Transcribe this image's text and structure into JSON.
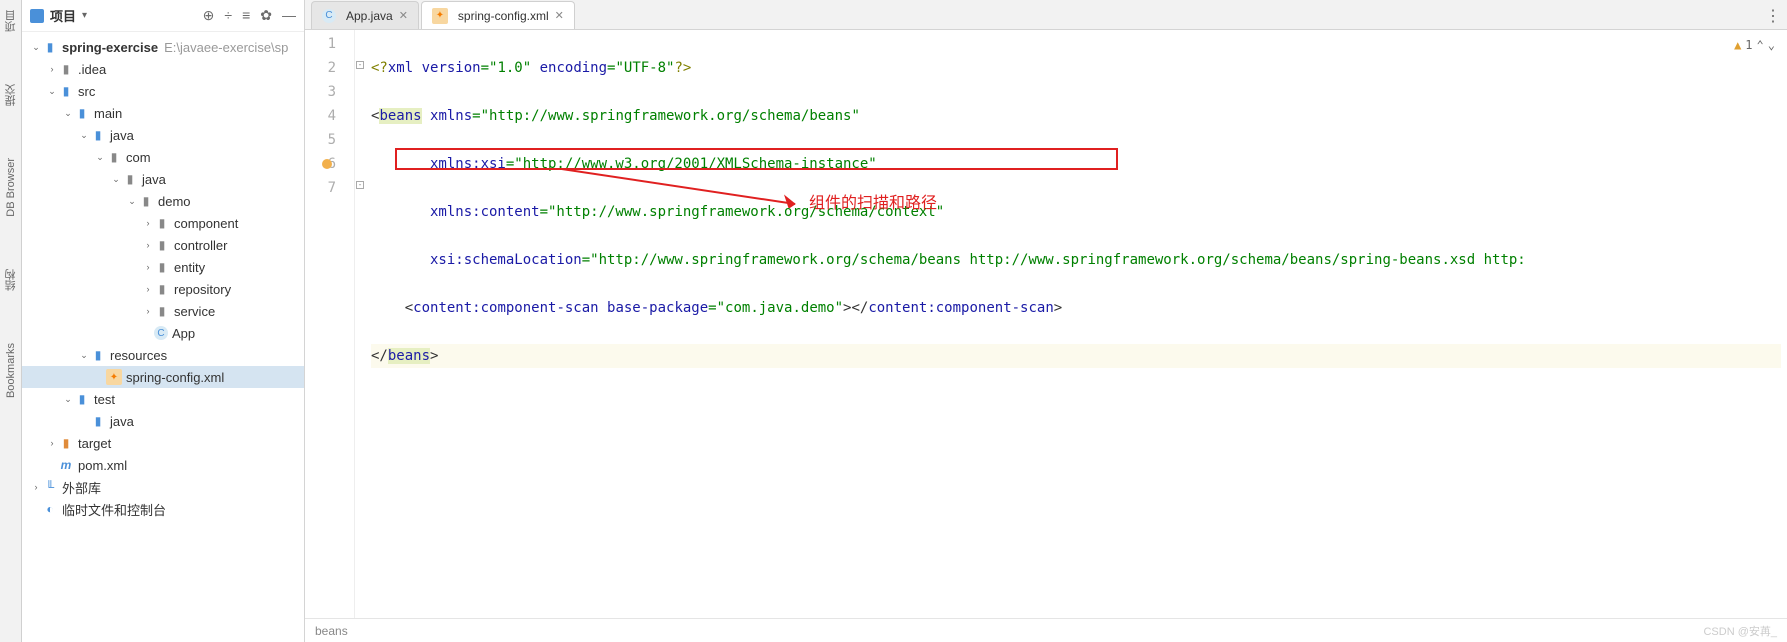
{
  "leftRail": {
    "items": [
      "项目",
      "提交",
      "DB Browser",
      "结构",
      "Bookmarks"
    ]
  },
  "sidebar": {
    "title": "项目",
    "toolbarIcons": [
      "target-icon",
      "expand-icon",
      "collapse-icon",
      "settings-icon",
      "hide-icon"
    ],
    "tree": [
      {
        "depth": 0,
        "chev": "v",
        "icon": "folder-blue",
        "label": "spring-exercise",
        "suffix": "E:\\javaee-exercise\\sp",
        "bold": true
      },
      {
        "depth": 1,
        "chev": ">",
        "icon": "folder-gray",
        "label": ".idea"
      },
      {
        "depth": 1,
        "chev": "v",
        "icon": "folder-blue",
        "label": "src"
      },
      {
        "depth": 2,
        "chev": "v",
        "icon": "folder-blue",
        "label": "main"
      },
      {
        "depth": 3,
        "chev": "v",
        "icon": "folder-blue",
        "label": "java"
      },
      {
        "depth": 4,
        "chev": "v",
        "icon": "folder-gray",
        "label": "com"
      },
      {
        "depth": 5,
        "chev": "v",
        "icon": "folder-gray",
        "label": "java"
      },
      {
        "depth": 6,
        "chev": "v",
        "icon": "folder-gray",
        "label": "demo"
      },
      {
        "depth": 7,
        "chev": ">",
        "icon": "folder-gray",
        "label": "component"
      },
      {
        "depth": 7,
        "chev": ">",
        "icon": "folder-gray",
        "label": "controller"
      },
      {
        "depth": 7,
        "chev": ">",
        "icon": "folder-gray",
        "label": "entity"
      },
      {
        "depth": 7,
        "chev": ">",
        "icon": "folder-gray",
        "label": "repository"
      },
      {
        "depth": 7,
        "chev": ">",
        "icon": "folder-gray",
        "label": "service"
      },
      {
        "depth": 7,
        "chev": "",
        "icon": "c-class",
        "label": "App"
      },
      {
        "depth": 3,
        "chev": "v",
        "icon": "folder-blue",
        "label": "resources"
      },
      {
        "depth": 4,
        "chev": "",
        "icon": "xml",
        "label": "spring-config.xml",
        "selected": true
      },
      {
        "depth": 2,
        "chev": "v",
        "icon": "folder-blue",
        "label": "test"
      },
      {
        "depth": 3,
        "chev": "",
        "icon": "folder-blue",
        "label": "java"
      },
      {
        "depth": 1,
        "chev": ">",
        "icon": "folder-orange",
        "label": "target"
      },
      {
        "depth": 1,
        "chev": "",
        "icon": "maven",
        "label": "pom.xml"
      },
      {
        "depth": 0,
        "chev": ">",
        "icon": "lib",
        "label": "外部库"
      },
      {
        "depth": 0,
        "chev": "",
        "icon": "scratch",
        "label": "临时文件和控制台"
      }
    ]
  },
  "tabs": {
    "items": [
      {
        "icon": "c-class",
        "label": "App.java",
        "active": false
      },
      {
        "icon": "xml",
        "label": "spring-config.xml",
        "active": true
      }
    ]
  },
  "editor": {
    "lineCount": 7,
    "warnCount": "1",
    "lines": {
      "l1_pre": "<?",
      "l1_tag": "xml",
      "l1_attr1": " version",
      "l1_val1": "=\"1.0\"",
      "l1_attr2": " encoding",
      "l1_val2": "=\"UTF-8\"",
      "l1_post": "?>",
      "l2_open": "<",
      "l2_tag": "beans",
      "l2_attr": " xmlns",
      "l2_val": "=\"http://www.springframework.org/schema/beans\"",
      "l3_attr": "       xmlns:xsi",
      "l3_val": "=\"http://www.w3.org/2001/XMLSchema-instance\"",
      "l4_attr": "       xmlns:content",
      "l4_val": "=\"http://www.springframework.org/schema/context\"",
      "l5_attr": "       xsi:schemaLocation",
      "l5_val": "=\"http://www.springframework.org/schema/beans http://www.springframework.org/schema/beans/spring-beans.xsd http:",
      "l6_open": "    <",
      "l6_tag": "content:component-scan",
      "l6_attr": " base-package",
      "l6_val": "=\"com.java.demo\"",
      "l6_close_open": "></",
      "l6_tag2": "content:component-scan",
      "l6_close": ">",
      "l7_open": "</",
      "l7_tag": "beans",
      "l7_close": ">"
    },
    "annotation": "组件的扫描和路径",
    "breadcrumb": "beans",
    "watermark": "CSDN @安苒_"
  }
}
